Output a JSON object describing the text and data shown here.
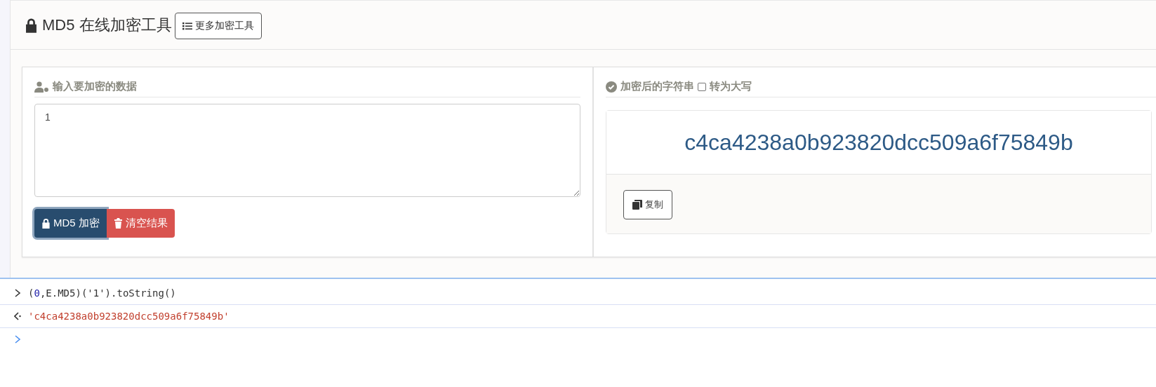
{
  "header": {
    "title": "MD5 在线加密工具",
    "more_button": "更多加密工具"
  },
  "input_panel": {
    "heading": "输入要加密的数据",
    "value": "1",
    "buttons": [
      {
        "label": "MD5 加密",
        "kind": "primary",
        "focused": true
      },
      {
        "label": "清空结果",
        "kind": "danger",
        "focused": false
      }
    ]
  },
  "output_panel": {
    "heading": "加密后的字符串",
    "uppercase": {
      "label": "转为大写",
      "checked": false
    },
    "result": "c4ca4238a0b923820dcc509a6f75849b",
    "copy_button": "复制"
  },
  "console": {
    "entries": [
      {
        "kind": "input",
        "segments": [
          {
            "text": "(",
            "kind": "plain"
          },
          {
            "text": "0",
            "kind": "number"
          },
          {
            "text": ",E.MD5)('1').toString()",
            "kind": "plain"
          }
        ]
      },
      {
        "kind": "output",
        "segments": [
          {
            "text": "'c4ca4238a0b923820dcc509a6f75849b'",
            "kind": "string"
          }
        ]
      },
      {
        "kind": "prompt"
      }
    ]
  }
}
